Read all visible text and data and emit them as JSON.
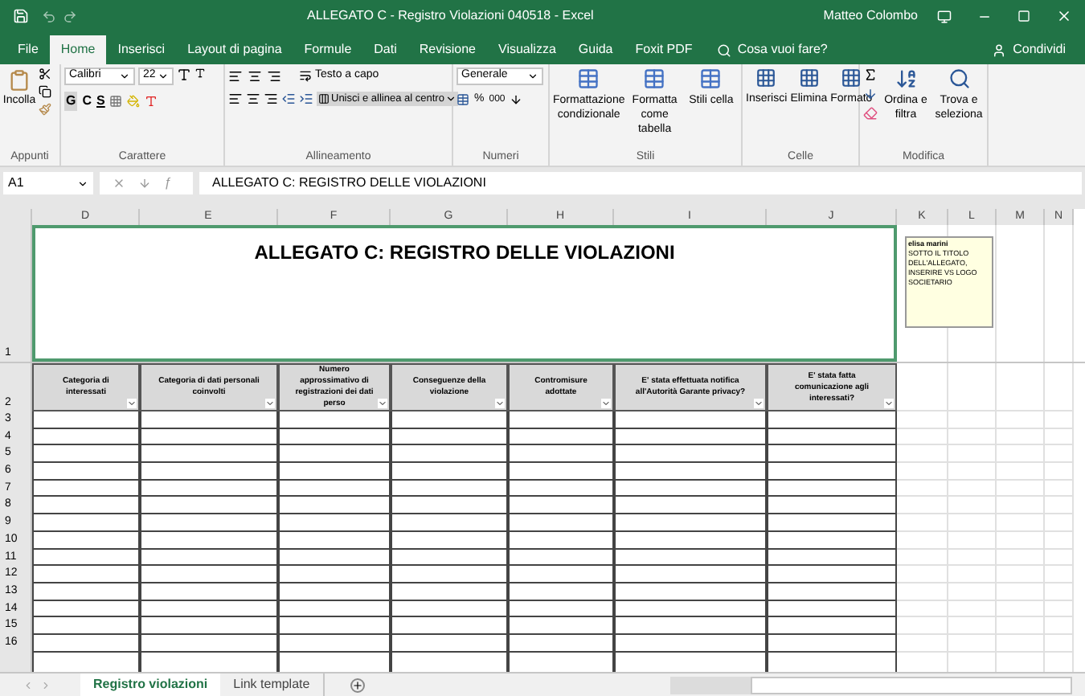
{
  "title_bar": {
    "title": "ALLEGATO C - Registro Violazioni 040518  -  Excel",
    "user": "Matteo Colombo"
  },
  "ribbon_tabs": [
    {
      "label": "File",
      "selected": false
    },
    {
      "label": "Home",
      "selected": true
    },
    {
      "label": "Inserisci",
      "selected": false
    },
    {
      "label": "Layout di pagina",
      "selected": false
    },
    {
      "label": "Formule",
      "selected": false
    },
    {
      "label": "Dati",
      "selected": false
    },
    {
      "label": "Revisione",
      "selected": false
    },
    {
      "label": "Visualizza",
      "selected": false
    },
    {
      "label": "Guida",
      "selected": false
    },
    {
      "label": "Foxit PDF",
      "selected": false
    }
  ],
  "search": {
    "placeholder": "Cosa vuoi fare?"
  },
  "share": "Condividi",
  "ribbon": {
    "paste": "Incolla",
    "font_name": "Calibri",
    "font_size": "22",
    "bold": "G",
    "italic": "C",
    "underline": "S",
    "wrap_text": "Testo a capo",
    "merge": "Unisci e allinea al centro",
    "number_format": "Generale",
    "percent": "%",
    "thousands": "000",
    "styles": [
      "Formattazione condizionale",
      "Formatta come tabella",
      "Stili cella"
    ],
    "cells": [
      "Inserisci",
      "Elimina",
      "Formato"
    ],
    "editing": [
      "Ordina e filtra",
      "Trova e seleziona"
    ],
    "groups": [
      "Appunti",
      "Carattere",
      "Allineamento",
      "Numeri",
      "Stili",
      "Celle",
      "Modifica"
    ]
  },
  "formula_bar": {
    "name_box": "A1",
    "function_symbol": "ƒ",
    "formula": "ALLEGATO C: REGISTRO DELLE VIOLAZIONI"
  },
  "columns": [
    "D",
    "E",
    "F",
    "G",
    "H",
    "I",
    "J",
    "K",
    "L",
    "M",
    "N"
  ],
  "sheet": {
    "title": "ALLEGATO C: REGISTRO DELLE VIOLAZIONI",
    "headers": [
      "Categoria di interessati",
      "Categoria di dati personali coinvolti",
      "Numero approssimativo di registrazioni dei dati perso",
      "Conseguenze della violazione",
      "Contromisure adottate",
      "E' stata effettuata notifica all'Autorità Garante privacy?",
      "E' stata fatta comunicazione agli interessati?"
    ],
    "row_numbers": [
      "1",
      "2",
      "3",
      "4",
      "5",
      "6",
      "7",
      "8",
      "9",
      "10",
      "11",
      "12",
      "13",
      "14",
      "15",
      "16"
    ]
  },
  "comment": {
    "author": "elisa marini",
    "text": "SOTTO IL TITOLO DELL'ALLEGATO, INSERIRE VS LOGO SOCIETARIO"
  },
  "sheet_tabs": [
    {
      "label": "Registro violazioni",
      "selected": true
    },
    {
      "label": "Link template",
      "selected": false
    }
  ]
}
